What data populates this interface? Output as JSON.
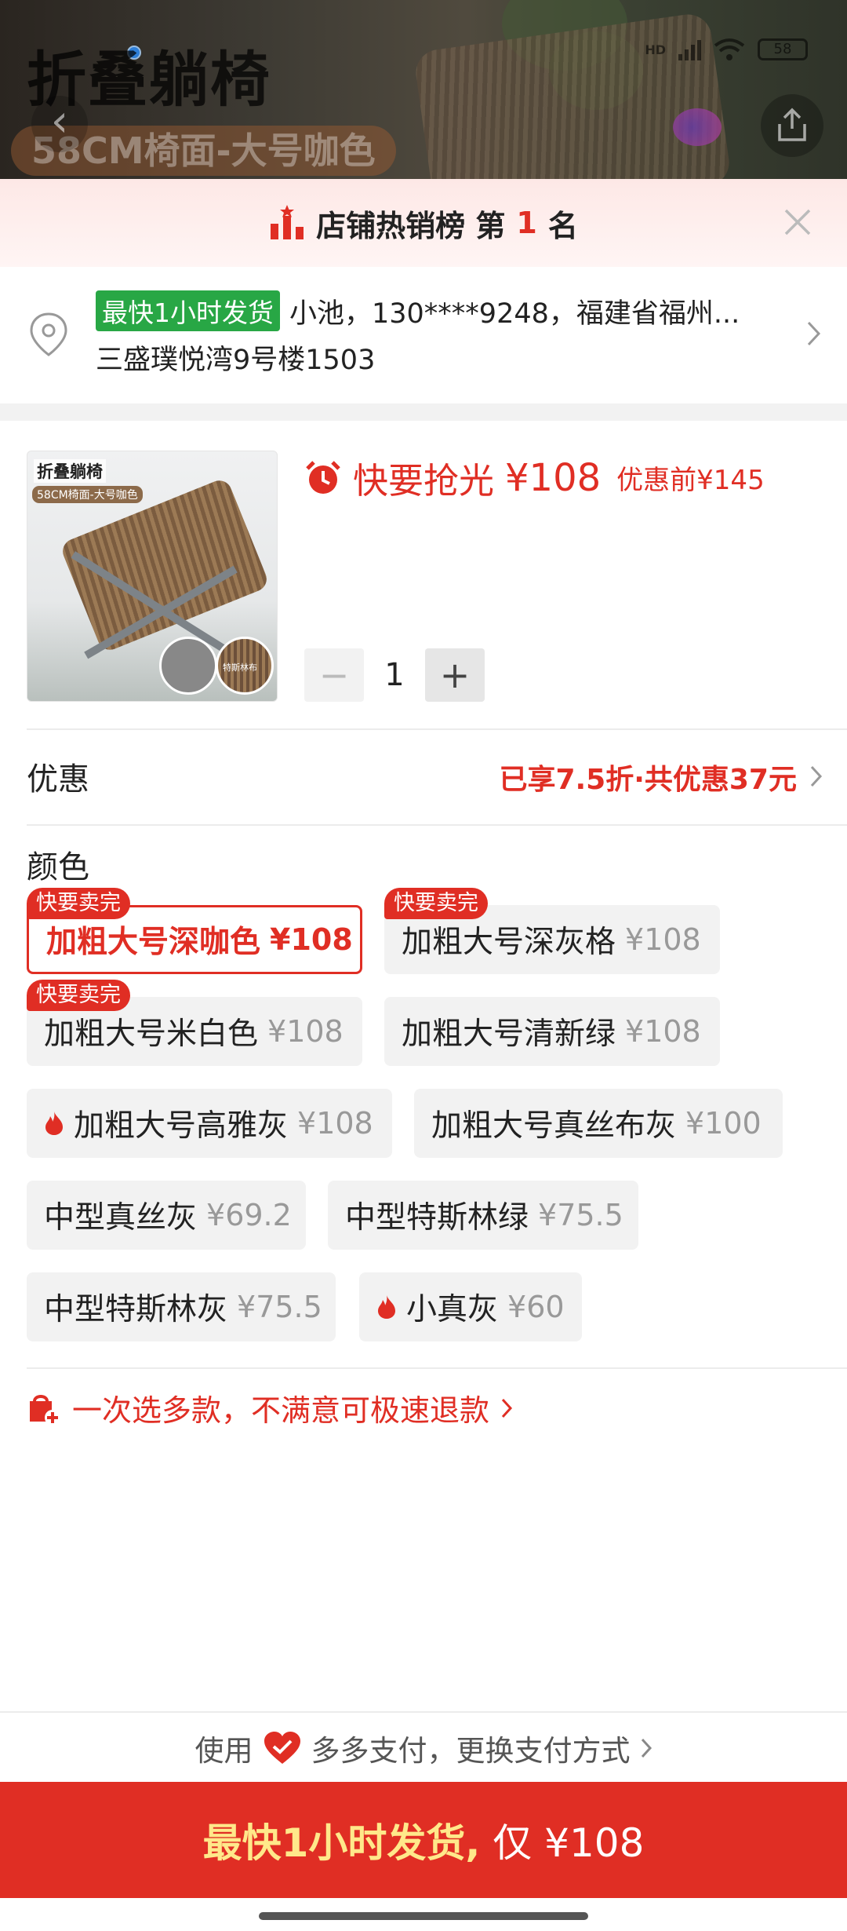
{
  "banner": {
    "title": "折叠躺椅",
    "subtitle": "58CM椅面-大号咖色",
    "status": {
      "network": "HD",
      "battery": "58"
    }
  },
  "rank": {
    "prefix": "店铺热销榜 第",
    "num": "1",
    "suffix": "名"
  },
  "address": {
    "fast_badge": "最快1小时发货",
    "line1": "小池，130****9248，福建省福州...",
    "line2": "三盛璞悦湾9号楼1503"
  },
  "product": {
    "image_title": "折叠躺椅",
    "image_sub": "58CM椅面-大号咖色",
    "image_tag": "特斯林布",
    "hurry": "快要抢光",
    "price": "¥108",
    "original": "优惠前¥145",
    "quantity": "1",
    "minus": "−",
    "plus": "+"
  },
  "discount": {
    "label": "优惠",
    "value": "已享7.5折·共优惠37元"
  },
  "colors": {
    "label": "颜色",
    "options": [
      {
        "name": "加粗大号深咖色",
        "price": "¥108",
        "tag": "快要卖完"
      },
      {
        "name": "加粗大号深灰格",
        "price": "¥108",
        "tag": "快要卖完"
      },
      {
        "name": "加粗大号米白色",
        "price": "¥108",
        "tag": "快要卖完"
      },
      {
        "name": "加粗大号清新绿",
        "price": "¥108",
        "tag": ""
      },
      {
        "name": "加粗大号高雅灰",
        "price": "¥108",
        "tag": ""
      },
      {
        "name": "加粗大号真丝布灰",
        "price": "¥100",
        "tag": ""
      },
      {
        "name": "中型真丝灰",
        "price": "¥69.2",
        "tag": ""
      },
      {
        "name": "中型特斯林绿",
        "price": "¥75.5",
        "tag": ""
      },
      {
        "name": "中型特斯林灰",
        "price": "¥75.5",
        "tag": ""
      },
      {
        "name": "小真灰",
        "price": "¥60",
        "tag": ""
      }
    ]
  },
  "multi": "一次选多款，不满意可极速退款",
  "payment": {
    "prefix": "使用",
    "suffix": "多多支付，更换支付方式"
  },
  "cta": {
    "highlight": "最快1小时发货,",
    "rest": "仅 ¥108"
  },
  "theme": {
    "accent": "#e02e24",
    "green": "#28a745"
  }
}
